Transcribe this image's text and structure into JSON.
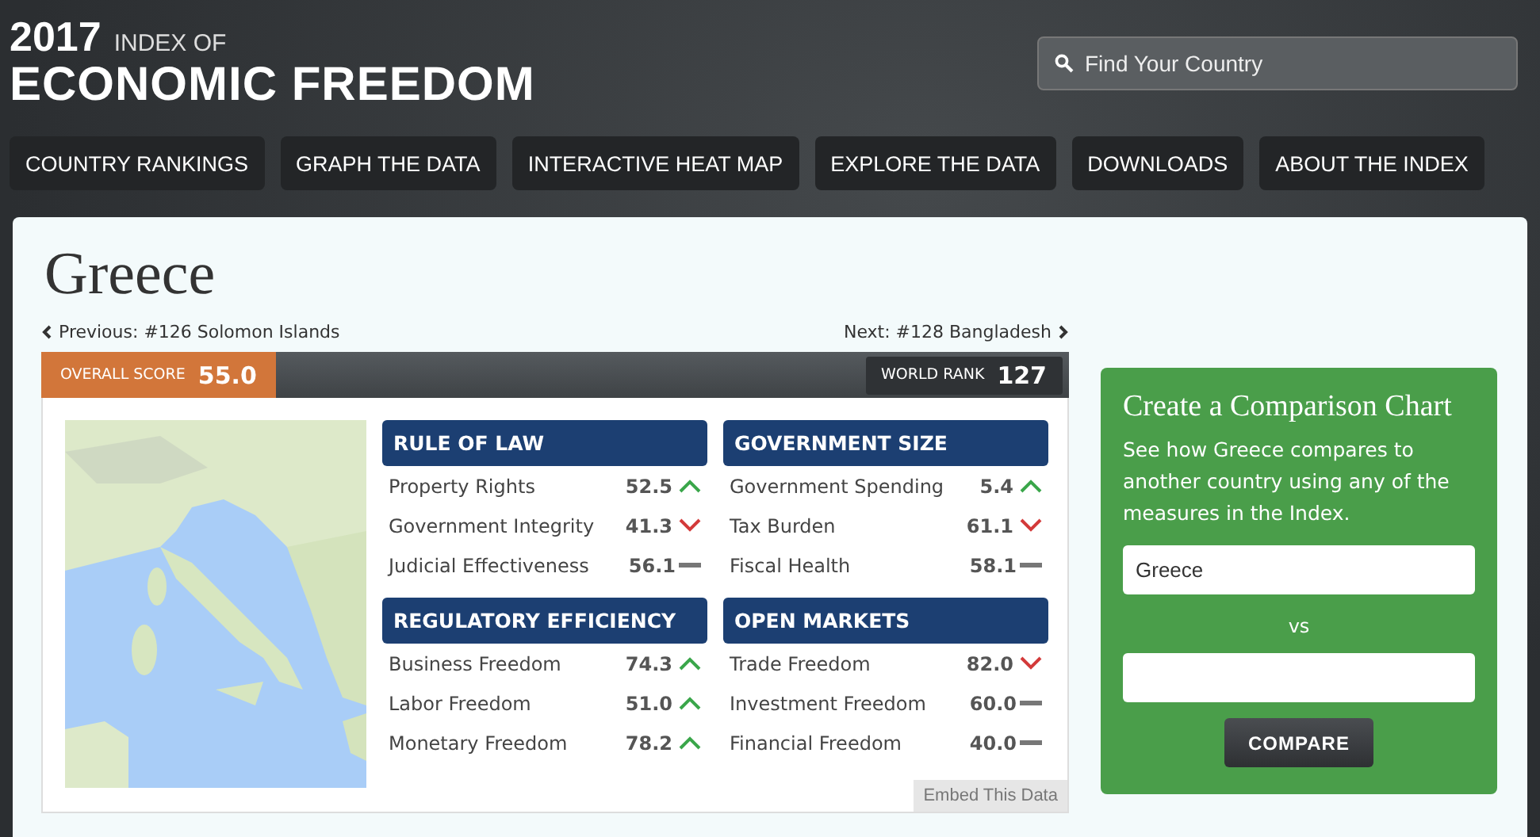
{
  "header": {
    "year": "2017",
    "subtitle": "INDEX OF",
    "title": "ECONOMIC FREEDOM",
    "search": {
      "placeholder": "Find Your Country"
    }
  },
  "nav": [
    "COUNTRY RANKINGS",
    "GRAPH THE DATA",
    "INTERACTIVE HEAT MAP",
    "EXPLORE THE DATA",
    "DOWNLOADS",
    "ABOUT THE INDEX"
  ],
  "country": {
    "name": "Greece",
    "previous": "Previous: #126 Solomon Islands",
    "next": "Next: #128 Bangladesh"
  },
  "score_bar": {
    "overall_label": "OVERALL SCORE",
    "overall_value": "55.0",
    "rank_label": "WORLD RANK",
    "rank_value": "127"
  },
  "categories": [
    {
      "title": "RULE OF LAW",
      "measures": [
        {
          "name": "Property Rights",
          "value": "52.5",
          "kind": "up"
        },
        {
          "name": "Government Integrity",
          "value": "41.3",
          "kind": "down"
        },
        {
          "name": "Judicial Effectiveness",
          "value": "56.1",
          "kind": "flat"
        }
      ]
    },
    {
      "title": "GOVERNMENT SIZE",
      "measures": [
        {
          "name": "Government Spending",
          "value": "5.4",
          "kind": "up"
        },
        {
          "name": "Tax Burden",
          "value": "61.1",
          "kind": "down"
        },
        {
          "name": "Fiscal Health",
          "value": "58.1",
          "kind": "flat"
        }
      ]
    },
    {
      "title": "REGULATORY EFFICIENCY",
      "measures": [
        {
          "name": "Business Freedom",
          "value": "74.3",
          "kind": "up"
        },
        {
          "name": "Labor Freedom",
          "value": "51.0",
          "kind": "up"
        },
        {
          "name": "Monetary Freedom",
          "value": "78.2",
          "kind": "up"
        }
      ]
    },
    {
      "title": "OPEN MARKETS",
      "measures": [
        {
          "name": "Trade Freedom",
          "value": "82.0",
          "kind": "down"
        },
        {
          "name": "Investment Freedom",
          "value": "60.0",
          "kind": "flat"
        },
        {
          "name": "Financial Freedom",
          "value": "40.0",
          "kind": "flat"
        }
      ]
    }
  ],
  "embed_button": "Embed This Data",
  "comparison": {
    "title": "Create a Comparison Chart",
    "text": "See how Greece compares to another country using any of the measures in the Index.",
    "first_value": "Greece",
    "vs": "vs",
    "button": "COMPARE"
  }
}
